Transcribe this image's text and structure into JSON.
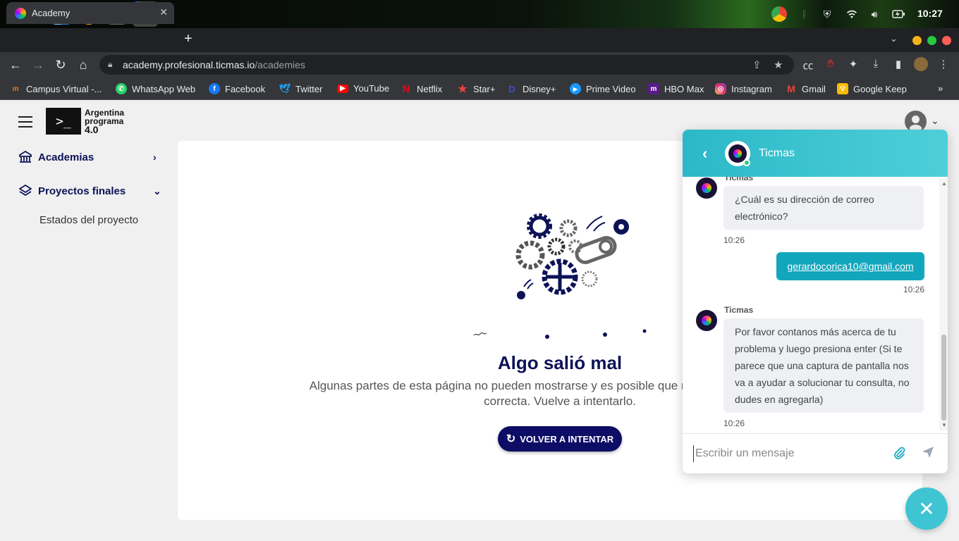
{
  "os": {
    "clock": "10:27",
    "chrome_badge": "2"
  },
  "browser": {
    "tab_title": "Academy",
    "url_host": "academy.profesional.ticmas.io",
    "url_path": "/academies",
    "bookmarks": [
      {
        "label": "Campus Virtual -...",
        "icon": "campus-icon",
        "color": "#ff7a00"
      },
      {
        "label": "WhatsApp Web",
        "icon": "whatsapp-icon",
        "color": "#25d366"
      },
      {
        "label": "Facebook",
        "icon": "facebook-icon",
        "color": "#1877f2"
      },
      {
        "label": "Twitter",
        "icon": "twitter-icon",
        "color": "#1da1f2"
      },
      {
        "label": "YouTube",
        "icon": "youtube-icon",
        "color": "#ff0000"
      },
      {
        "label": "Netflix",
        "icon": "netflix-icon",
        "color": "#e50914"
      },
      {
        "label": "Star+",
        "icon": "star-icon",
        "color": "#e9443a"
      },
      {
        "label": "Disney+",
        "icon": "disney-icon",
        "color": "#3b4fd8"
      },
      {
        "label": "Prime Video",
        "icon": "prime-icon",
        "color": "#1a98ff"
      },
      {
        "label": "HBO Max",
        "icon": "hbo-icon",
        "color": "#5a1a8a"
      },
      {
        "label": "Instagram",
        "icon": "instagram-icon",
        "color": "#e1306c"
      },
      {
        "label": "Gmail",
        "icon": "gmail-icon",
        "color": "#ea4335"
      },
      {
        "label": "Google Keep",
        "icon": "keep-icon",
        "color": "#fbbc04"
      }
    ]
  },
  "app": {
    "logo_line1": "Argentina",
    "logo_line2": "programa",
    "logo_line3": "4.0",
    "sidebar": {
      "items": [
        {
          "label": "Academias",
          "icon": "academy-icon"
        },
        {
          "label": "Proyectos finales",
          "icon": "layers-icon"
        }
      ],
      "sub_item": "Estados del proyecto"
    },
    "error": {
      "title": "Algo salió mal",
      "description": "Algunas partes de esta página no pueden mostrarse y es posible que no funcionen de manera correcta. Vuelve a intentarlo.",
      "retry_label": "VOLVER A INTENTAR"
    }
  },
  "chat": {
    "title": "Ticmas",
    "messages": [
      {
        "sender": "Ticmas",
        "text": "¿Cuál es su dirección de correo electrónico?",
        "time": "10:26"
      },
      {
        "sender": "me",
        "text": "gerardocorica10@gmail.com",
        "time": "10:26"
      },
      {
        "sender": "Ticmas",
        "text": "Por favor contanos más acerca de tu problema y luego presiona enter (Si te parece que una captura de pantalla nos va a ayudar a solucionar tu consulta, no dudes en agregarla)",
        "time": "10:26"
      }
    ],
    "input_placeholder": "Escribir un mensaje",
    "accent_color": "#3fc4d3"
  }
}
